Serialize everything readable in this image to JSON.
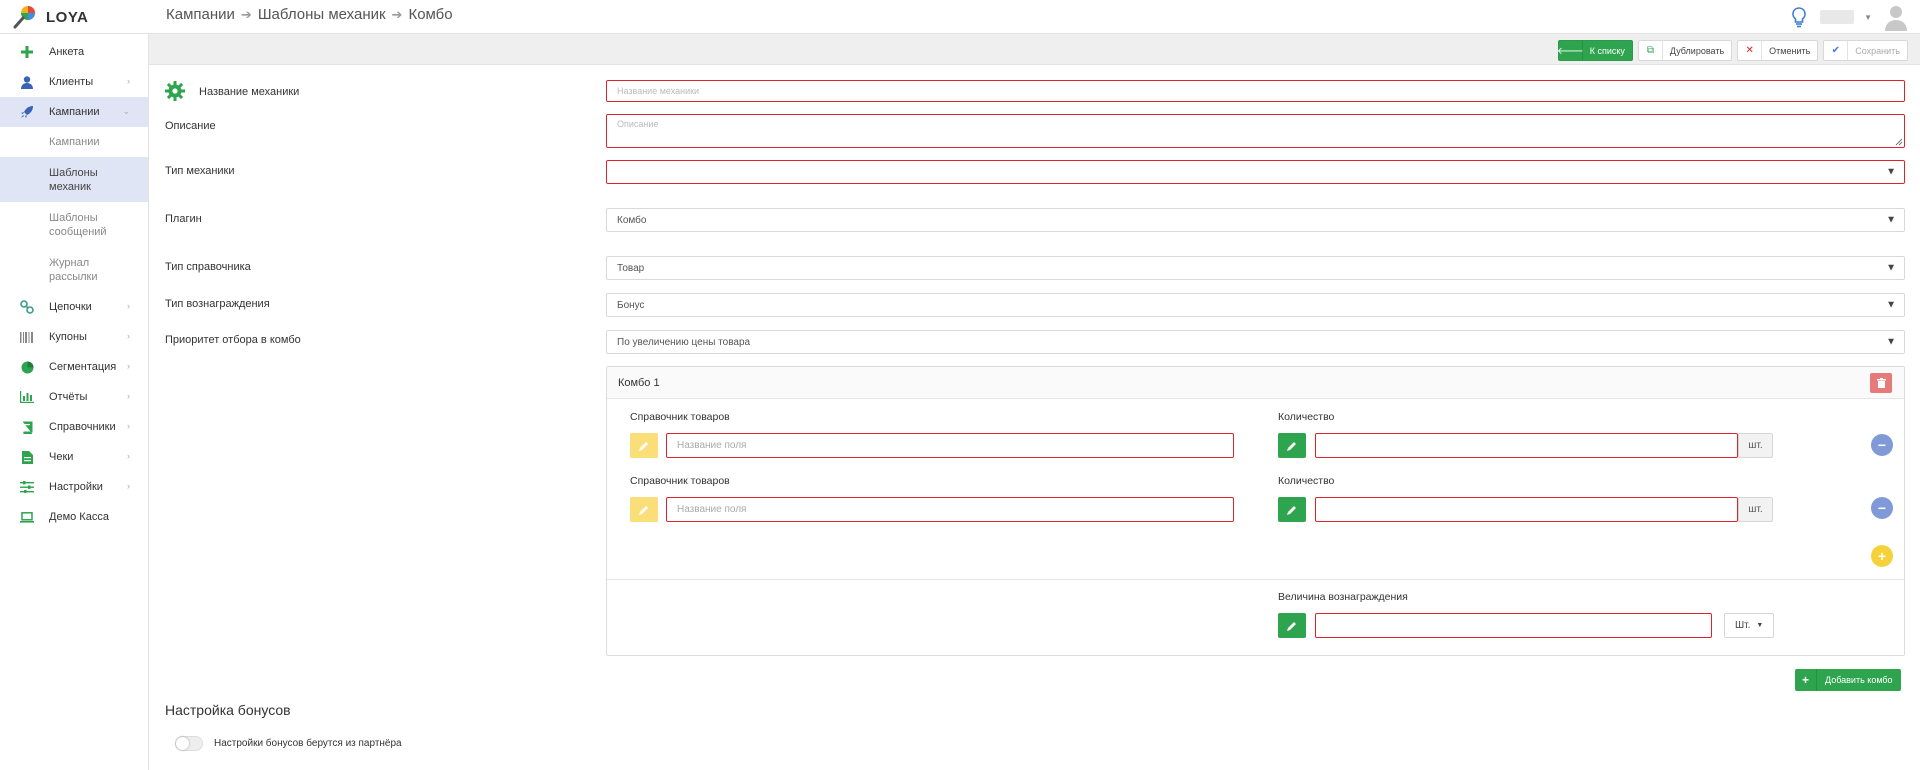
{
  "app": {
    "name": "LOYA"
  },
  "breadcrumb": [
    "Кампании",
    "Шаблоны механик",
    "Комбо"
  ],
  "sidebar": {
    "items": [
      {
        "label": "Анкета"
      },
      {
        "label": "Клиенты"
      },
      {
        "label": "Кампании"
      },
      {
        "label": "Цепочки"
      },
      {
        "label": "Купоны"
      },
      {
        "label": "Сегментация"
      },
      {
        "label": "Отчёты"
      },
      {
        "label": "Справочники"
      },
      {
        "label": "Чеки"
      },
      {
        "label": "Настройки"
      },
      {
        "label": "Демо Касса"
      }
    ],
    "sub_items": [
      {
        "label": "Кампании"
      },
      {
        "label": "Шаблоны механик"
      },
      {
        "label": "Шаблоны сообщений"
      },
      {
        "label": "Журнал рассылки"
      }
    ]
  },
  "toolbar": {
    "to_list": "К списку",
    "duplicate": "Дублировать",
    "cancel": "Отменить",
    "save": "Сохранить"
  },
  "form": {
    "name_label": "Название механики",
    "name_placeholder": "Название механики",
    "description_label": "Описание",
    "description_placeholder": "Описание",
    "type_label": "Тип механики",
    "type_value": "",
    "plugin_label": "Плагин",
    "plugin_value": "Комбо",
    "directory_type_label": "Тип справочника",
    "directory_type_value": "Товар",
    "reward_type_label": "Тип вознаграждения",
    "reward_type_value": "Бонус",
    "priority_label": "Приоритет отбора в комбо",
    "priority_value": "По увеличению цены товара"
  },
  "combo": {
    "title": "Комбо 1",
    "rows": [
      {
        "directory_label": "Справочник товаров",
        "directory_placeholder": "Название поля",
        "quantity_label": "Количество",
        "unit": "шт."
      },
      {
        "directory_label": "Справочник товаров",
        "directory_placeholder": "Название поля",
        "quantity_label": "Количество",
        "unit": "шт."
      }
    ],
    "reward_label": "Величина вознаграждения",
    "reward_unit": "Шт."
  },
  "add_combo": "Добавить комбо",
  "bonus_section": {
    "title": "Настройка бонусов",
    "toggle_label": "Настройки бонусов берутся из партнёра",
    "toggle_on": false
  },
  "colors": {
    "accent_green": "#2ea44f",
    "error_red": "#d9262c",
    "active_bg": "#dfe5f4"
  }
}
